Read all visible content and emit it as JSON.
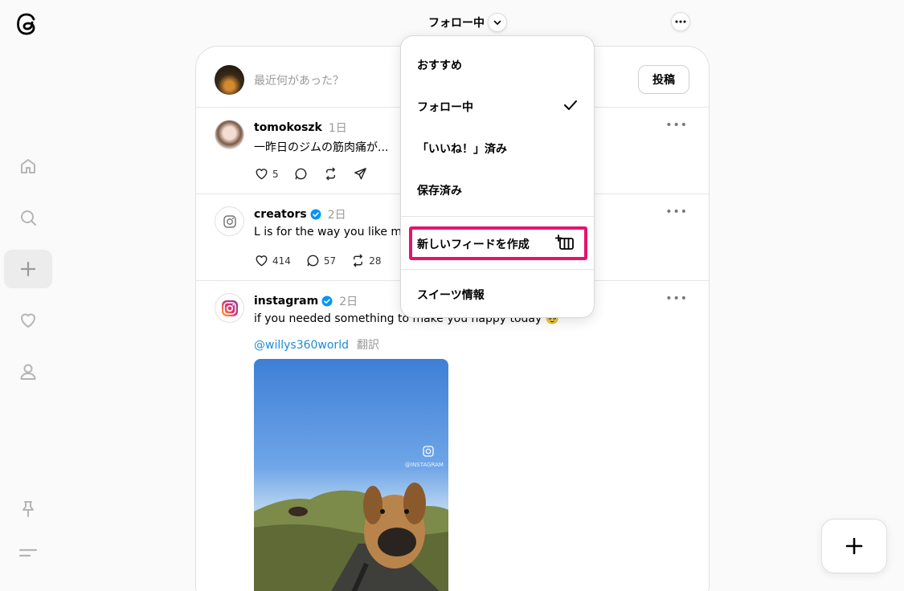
{
  "header": {
    "feed_title": "フォロー中"
  },
  "composer": {
    "placeholder": "最近何があった？",
    "post_label": "投稿"
  },
  "posts": [
    {
      "username": "tomokoszk",
      "time": "1日",
      "text": "一昨日のジムの筋肉痛が...",
      "likes": "5",
      "replies": "",
      "reposts": ""
    },
    {
      "username": "creators",
      "time": "2日",
      "text": "L is for the way you like my",
      "likes": "414",
      "replies": "57",
      "reposts": "28"
    },
    {
      "username": "instagram",
      "time": "2日",
      "text": "if you needed something to make you happy today 🥹",
      "tag": "@willys360world",
      "translate": "翻訳",
      "media_watermark": "@INSTAGRAM"
    }
  ],
  "dropdown": {
    "items": [
      "おすすめ",
      "フォロー中",
      "「いいね！」済み",
      "保存済み"
    ],
    "create_feed": "新しいフィードを作成",
    "suites": "スイーツ情報"
  },
  "colors": {
    "highlight": "#e5136e",
    "link": "#1a8cd8",
    "verified": "#0095f6"
  }
}
